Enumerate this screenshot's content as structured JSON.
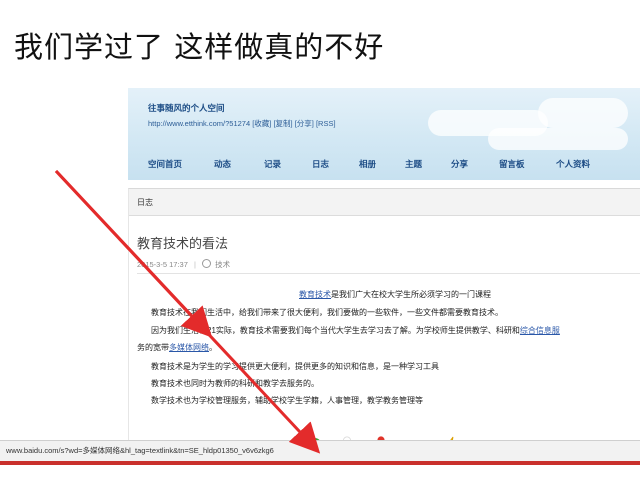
{
  "slide": {
    "title": "我们学过了 这样做真的不好"
  },
  "blog": {
    "name": "往事随风的个人空间",
    "url_line": "http://www.etthink.com/?51274 [收藏] [复制] [分享] [RSS]",
    "nav": [
      "空间首页",
      "动态",
      "记录",
      "日志",
      "相册",
      "主题",
      "分享",
      "留言板",
      "个人资料"
    ]
  },
  "section": {
    "label": "日志"
  },
  "article": {
    "title": "教育技术的看法",
    "date": "2015-3-5 17:37",
    "tag": "技术",
    "lines": [
      {
        "pre": "",
        "link": "教育技术",
        "post": "是我们广大在校大学生所必须学习的一门课程"
      },
      {
        "pre": "教育技术在我们生活中，给我们带来了很大便利，我们要做的一些软件，一些文件都需要教育技术。",
        "link": "",
        "post": ""
      },
      {
        "pre": "因为我们生活在21实际，教育技术需要我们每个当代大学生去学习去了解。为学校师生提供教学、科研和",
        "link": "综合信息服",
        "post": ""
      },
      {
        "pre": "务的宽带",
        "link": "多媒体网络",
        "post": "。"
      },
      {
        "pre": "教育技术是为学生的学习提供更大便利，提供更多的知识和信息，是一种学习工具",
        "link": "",
        "post": ""
      },
      {
        "pre": "教育技术也同时为教师的科研和教学去服务的。",
        "link": "",
        "post": ""
      },
      {
        "pre": "数学技术也为学校管理服务，辅助学校学生学籍，人事管理，教学教务管理等",
        "link": "",
        "post": ""
      }
    ]
  },
  "statusbar": {
    "text": "www.baidu.com/s?wd=多媒体网络&hl_tag=textlink&tn=SE_hldp01350_v6v6zkg6"
  },
  "icons": [
    "tree-icon",
    "flower-white-icon",
    "flower-red-icon",
    "handshake-icon",
    "lightning-icon"
  ],
  "colors": {
    "arrow": "#e32b2b",
    "nav_text": "#1d4d86",
    "link": "#2a57a8",
    "status_border": "#c9302c"
  }
}
